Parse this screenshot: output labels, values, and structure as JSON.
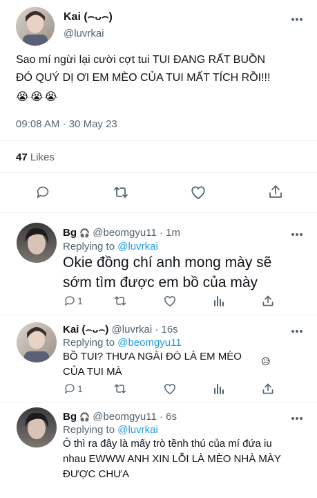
{
  "main_tweet": {
    "display_name": "Kai (⌢ᴗ⌢)",
    "handle": "@luvrkai",
    "text_line1": "Sao mí ngừi lại cười cợt tui TUI ĐANG RẤT BUỒN",
    "text_line2": "ĐÓ QUÝ DỊ ƠI EM MÈO CỦA TUI MẤT TÍCH RỒI!!!",
    "emojis": "😭😭😭",
    "time": "09:08 AM",
    "dot": "·",
    "date": "30 May 23",
    "likes_count": "47",
    "likes_label": "Likes"
  },
  "replies": [
    {
      "display_name": "Bg",
      "badge": "🎧",
      "handle": "@beomgyu11",
      "dot": "·",
      "age": "1m",
      "replying_label": "Replying to",
      "replying_handle": "@luvrkai",
      "text_line1": "Okie đồng chí anh mong mày sẽ",
      "text_line2": "sớm tìm được em bồ của mày",
      "reply_count": "1"
    },
    {
      "display_name": "Kai (⌢ᴗ⌢)",
      "handle": "@luvrkai",
      "dot": "·",
      "age": "16s",
      "replying_label": "Replying to",
      "replying_handle": "@beomgyu11",
      "text_line1": "BỒ TUI? THƯA NGÀI ĐÓ LÀ EM MÈO",
      "text_line2": "CỦA TUI MÀ",
      "emoji": "😥",
      "reply_count": "1"
    },
    {
      "display_name": "Bg",
      "badge": "🎧",
      "handle": "@beomgyu11",
      "dot": "·",
      "age": "6s",
      "replying_label": "Replying to",
      "replying_handle": "@luvrkai",
      "text_line1": "Ô thì ra đây là mấy trò tềnh thú của mí đứa iu",
      "text_line2": "nhau EWWW ANH XIN LỖI LÀ MÈO NHÀ MÀY",
      "text_line3": "ĐƯỢC CHƯA"
    }
  ],
  "colors": {
    "accent": "#1d9bf0",
    "muted": "#536471",
    "divider": "#eff3f4"
  }
}
